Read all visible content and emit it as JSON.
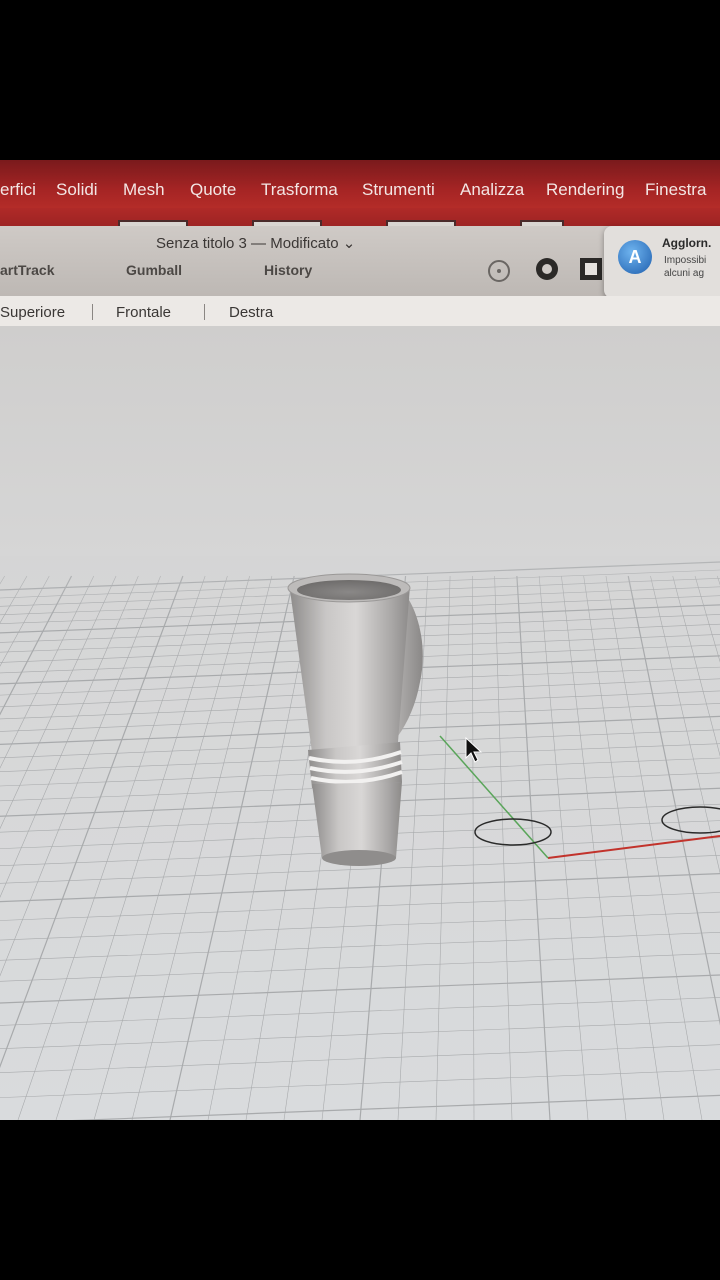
{
  "menu": {
    "items": [
      "erfici",
      "Solidi",
      "Mesh",
      "Quote",
      "Trasforma",
      "Strumenti",
      "Analizza",
      "Rendering",
      "Finestra"
    ]
  },
  "window": {
    "title": "Senza titolo 3 — Modificato ⌄"
  },
  "toolbar": {
    "buttons": [
      "artTrack",
      "Gumball",
      "History"
    ]
  },
  "notification": {
    "title": "Agglorn.",
    "line1": "Impossibi",
    "line2": "alcuni ag"
  },
  "view_tabs": [
    "Superiore",
    "Frontale",
    "Destra"
  ],
  "colors": {
    "menubar": "#a42424",
    "x_axis": "#c2332c",
    "y_axis": "#5aa55a",
    "grid": "#a8aaac"
  }
}
